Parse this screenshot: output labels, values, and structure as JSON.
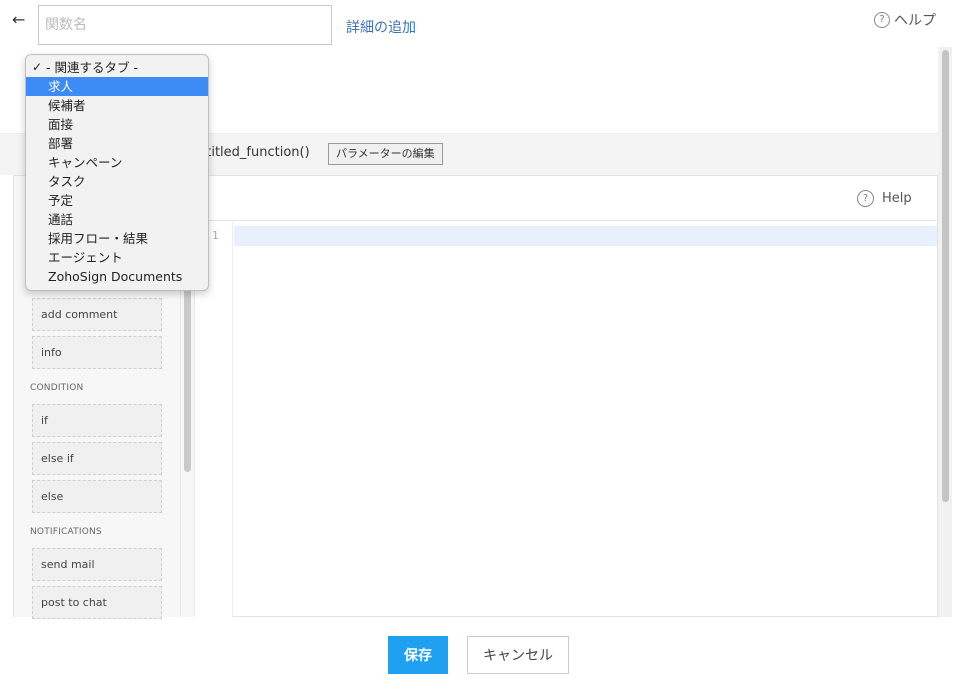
{
  "header": {
    "back_icon": "←",
    "function_name_placeholder": "関数名",
    "function_name_value": "",
    "add_detail_label": "詳細の追加",
    "help_label": "ヘルプ",
    "help_icon": "?"
  },
  "signature": {
    "text": "ntitled_function()",
    "edit_params_label": "パラメーターの編集"
  },
  "editor": {
    "help_label": "Help",
    "help_icon": "?",
    "line_number": "1"
  },
  "palette": {
    "items_top": [
      "add comment",
      "info"
    ],
    "condition_title": "CONDITION",
    "condition_items": [
      "if",
      "else if",
      "else"
    ],
    "notifications_title": "NOTIFICATIONS",
    "notification_items": [
      "send mail",
      "post to chat"
    ]
  },
  "dropdown": {
    "selected_label": "- 関連するタブ -",
    "check_icon": "✓",
    "options": [
      "求人",
      "候補者",
      "面接",
      "部署",
      "キャンペーン",
      "タスク",
      "予定",
      "通話",
      "採用フロー・結果",
      "エージェント",
      "ZohoSign Documents"
    ],
    "highlighted": "求人"
  },
  "footer": {
    "save_label": "保存",
    "cancel_label": "キャンセル"
  },
  "colors": {
    "accent": "#1fa0f0",
    "highlight": "#3d8cf6",
    "link": "#3a73b8"
  }
}
